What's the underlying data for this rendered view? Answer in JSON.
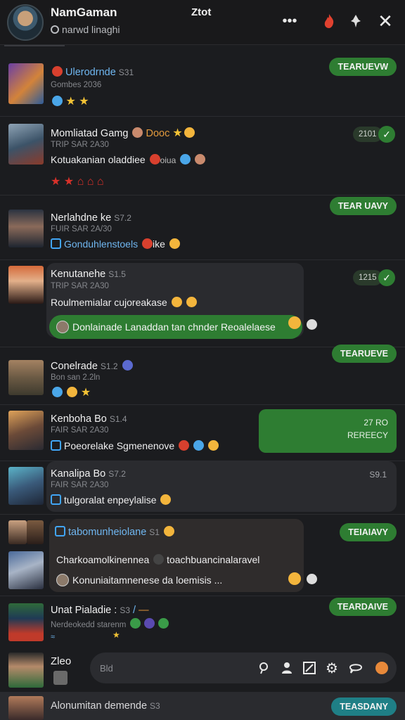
{
  "header": {
    "title": "NamGaman",
    "tag": "Ztot",
    "subtitle": "narwd linaghi",
    "icons": [
      "avatar",
      "more-icon",
      "fire-icon",
      "pin-icon",
      "close-icon"
    ]
  },
  "rows": [
    {
      "name": "Ulerodrnde",
      "num": "S31",
      "meta": "Gombes 2036",
      "pill": "TEARUEVW"
    },
    {
      "name": "Momliatad Gamg",
      "name_suffix": "Dooc",
      "meta": "TRIP SAR 2A30",
      "message": "Kotuakanian oladdiee",
      "message_suffix": "oiua",
      "chip": "2101"
    },
    {
      "name": "Nerlahdne ke",
      "num": "S7.2",
      "meta": "FUIR SAR 2A/30",
      "message": "Gonduhlenstoels",
      "message_suffix": "ike",
      "pill": "TEAR UAVY"
    },
    {
      "name": "Kenutanehe",
      "num": "S1.5",
      "meta": "TRIP SAR 2A30",
      "message": "Roulmemialar cujoreakase",
      "reply": "Donlainade Lanaddan tan chnder Reoalelaese",
      "chip": "1215"
    },
    {
      "name": "Conelrade",
      "num": "S1.2",
      "meta": "Bon san 2.2ln",
      "pill": "TEARUEVE"
    },
    {
      "name": "Kenboha Bo",
      "num": "S1.4",
      "meta": "FAIR SAR 2A30",
      "message": "Poeorelake Sgmenenove",
      "green_box_line1": "27 RO",
      "green_box_line2": "REREECY"
    },
    {
      "name": "Kanalipa Bo",
      "num": "S7.2",
      "meta": "FAIR SAR 2A30",
      "message": "tulgoralat enpeylalise",
      "box_num": "S9.1"
    },
    {
      "name": "tabomunheiolane",
      "num": "S1",
      "message": "Charkoamolkinennea",
      "message_suffix": "toachbuancinalaravel",
      "reply": "Konuniaitamnenese da loemisis ...",
      "pill": "TEIAIAVY"
    },
    {
      "name": "Unat Pialadie :",
      "num": "S3",
      "meta": "Nerdeokedd starenm",
      "pill": "TEARDAIVE"
    },
    {
      "name": "Zleo"
    },
    {
      "name": "Alonumitan demende",
      "num": "S3",
      "pill": "TEASDANY"
    }
  ],
  "composer": {
    "placeholder": "Bld",
    "icons": [
      "search-icon",
      "user-icon",
      "image-icon",
      "settings-icon",
      "chat-icon",
      "emoji-icon"
    ]
  },
  "colors": {
    "background": "#1b1c1f",
    "accent_green": "#2e7d32",
    "accent_teal": "#1f7f86"
  }
}
